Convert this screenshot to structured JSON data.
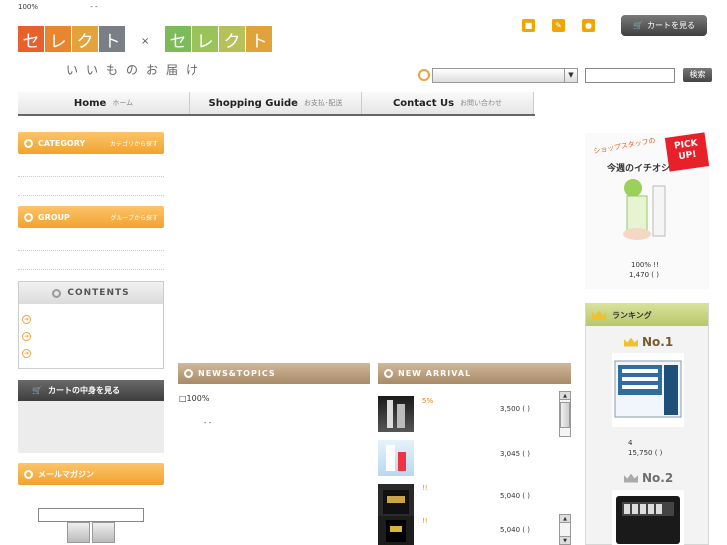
{
  "header": {
    "top_text": "100%",
    "top_text_dashes": "-  -",
    "logo_left": [
      "セ",
      "レ",
      "ク",
      "ト"
    ],
    "logo_right": [
      "セ",
      "レ",
      "ク",
      "ト"
    ],
    "logo_separator": "×",
    "tagline": "いいものお届け",
    "cart_button_label": "カートを見る",
    "search_button_label": "検索",
    "search_select_value": "",
    "search_input_value": "",
    "icons": [
      "lock-icon",
      "pencil-icon",
      "user-icon"
    ]
  },
  "colors": {
    "logo_left": [
      "#e8612c",
      "#e7862e",
      "#e2a43a",
      "#7a7f85"
    ],
    "logo_right": [
      "#7dbb5a",
      "#9ac35a",
      "#b6c15a",
      "#e0a33b"
    ],
    "accent_orange": "#f0a32e",
    "brown_header": "#a88a66",
    "ranking_header": "#b9c66a",
    "pick_up_red": "#e8202a"
  },
  "nav": [
    {
      "en": "Home",
      "jp": "ホーム"
    },
    {
      "en": "Shopping Guide",
      "jp": "お支払･配送"
    },
    {
      "en": "Contact Us",
      "jp": "お問い合わせ"
    }
  ],
  "left": {
    "category_label": "CATEGORY",
    "category_sub": "カテゴリから探す",
    "group_label": "GROUP",
    "group_sub": "グループから探す",
    "contents_label": "CONTENTS",
    "cart_label": "カートの中身を見る",
    "mail_label": "メールマガジン"
  },
  "center": {
    "news_label": "NEWS&TOPICS",
    "news_item": "□100%",
    "news_dashes": "-     -",
    "new_arrival_label": "NEW ARRIVAL",
    "products": [
      {
        "note": "5%",
        "price": "3,500 (   )"
      },
      {
        "note": "",
        "price": "3,045 (   )"
      },
      {
        "note": "!!",
        "price": "5,040 (   )"
      },
      {
        "note": "!!",
        "price": "5,040 (   )"
      }
    ]
  },
  "right": {
    "pickup_badge": "PICK UP!",
    "pickup_caption": "ショップスタッフの",
    "pickup_title": "今週のイチオシ",
    "pickup_line1": "100%          !!",
    "pickup_line2": "1,470 (   )",
    "ranking_label": "ランキング",
    "rank1_label": "No.1",
    "rank1_line1": "4",
    "rank1_line2": "15,750 (   )",
    "rank2_label": "No.2"
  }
}
